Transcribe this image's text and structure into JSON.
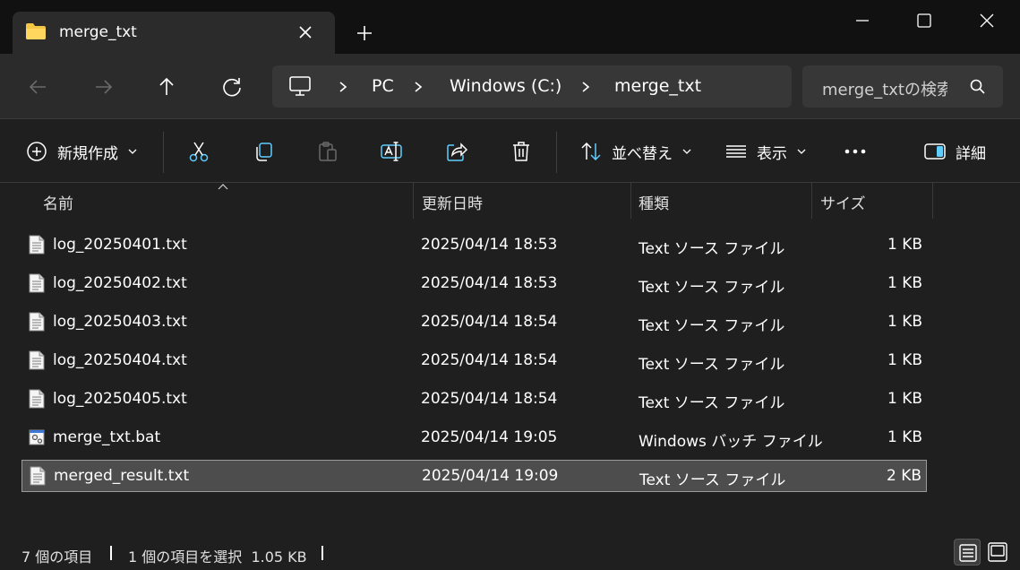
{
  "tab": {
    "title": "merge_txt"
  },
  "address": {
    "segments": [
      "PC",
      "Windows (C:)",
      "merge_txt"
    ]
  },
  "search": {
    "placeholder": "merge_txtの検索"
  },
  "toolbar": {
    "new_label": "新規作成",
    "sort_label": "並べ替え",
    "view_label": "表示",
    "details_label": "詳細"
  },
  "columns": {
    "name": "名前",
    "date": "更新日時",
    "type": "種類",
    "size": "サイズ"
  },
  "files": [
    {
      "name": "log_20250401.txt",
      "date": "2025/04/14 18:53",
      "type": "Text ソース ファイル",
      "size": "1 KB",
      "icon": "text-file-icon"
    },
    {
      "name": "log_20250402.txt",
      "date": "2025/04/14 18:53",
      "type": "Text ソース ファイル",
      "size": "1 KB",
      "icon": "text-file-icon"
    },
    {
      "name": "log_20250403.txt",
      "date": "2025/04/14 18:54",
      "type": "Text ソース ファイル",
      "size": "1 KB",
      "icon": "text-file-icon"
    },
    {
      "name": "log_20250404.txt",
      "date": "2025/04/14 18:54",
      "type": "Text ソース ファイル",
      "size": "1 KB",
      "icon": "text-file-icon"
    },
    {
      "name": "log_20250405.txt",
      "date": "2025/04/14 18:54",
      "type": "Text ソース ファイル",
      "size": "1 KB",
      "icon": "text-file-icon"
    },
    {
      "name": "merge_txt.bat",
      "date": "2025/04/14 19:05",
      "type": "Windows バッチ ファイル",
      "size": "1 KB",
      "icon": "batch-file-icon"
    },
    {
      "name": "merged_result.txt",
      "date": "2025/04/14 19:09",
      "type": "Text ソース ファイル",
      "size": "2 KB",
      "icon": "text-file-icon",
      "selected": true
    }
  ],
  "status": {
    "item_count": "7 個の項目",
    "selection": "1 個の項目を選択  1.05 KB"
  },
  "colors": {
    "folder": "#f2c744",
    "accent_blue": "#60cdff",
    "selection_bg": "#4d4d4d"
  }
}
